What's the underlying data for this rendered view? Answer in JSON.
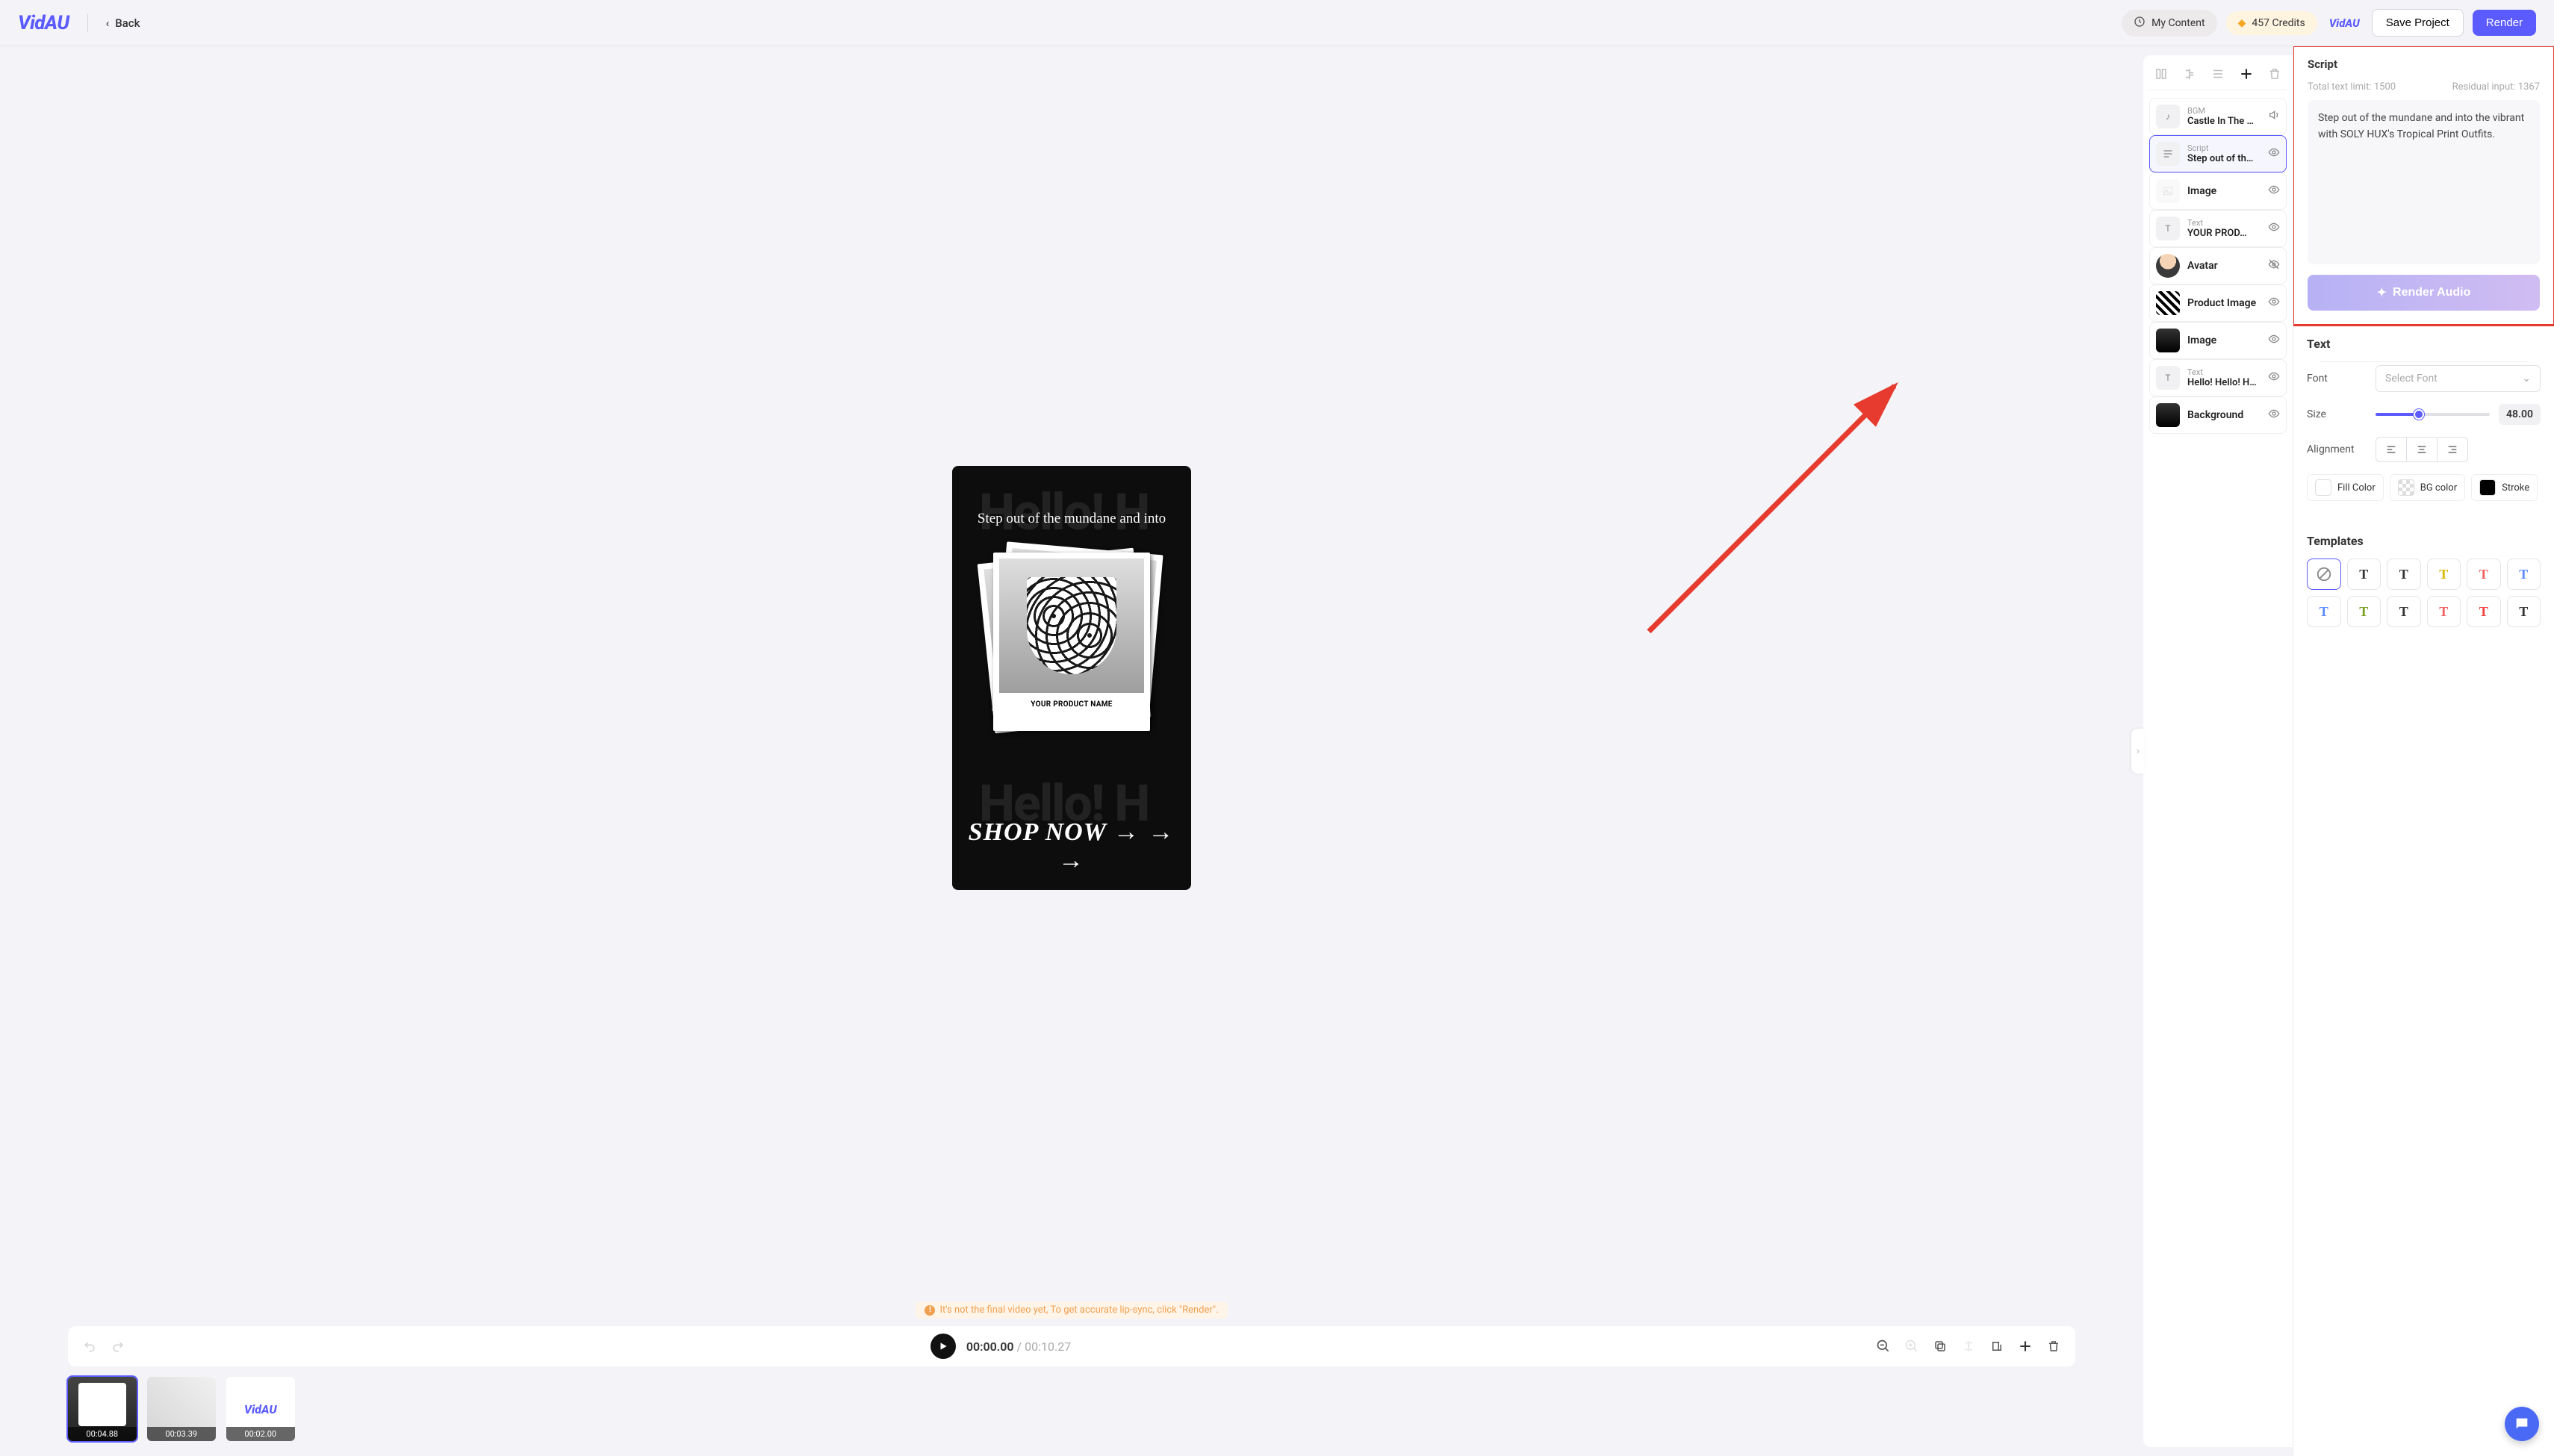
{
  "header": {
    "logo": "VidAU",
    "back": "Back",
    "my_content": "My Content",
    "credits": "457 Credits",
    "save": "Save Project",
    "render": "Render"
  },
  "canvas": {
    "headline": "Step out of the mundane and into",
    "product_caption": "YOUR PRODUCT NAME",
    "cta": "SHOP NOW",
    "bg_word": "Hello! H",
    "warning": "It's not the final video yet, To get accurate lip-sync, click \"Render\"."
  },
  "timeline": {
    "current": "00:00.00",
    "total": "00:10.27",
    "clips": [
      {
        "ts": "00:04.88"
      },
      {
        "ts": "00:03.39"
      },
      {
        "ts": "00:02.00"
      }
    ]
  },
  "layers": {
    "items": [
      {
        "label": "BGM",
        "value": "Castle In The …",
        "icon": "music",
        "right": "speaker"
      },
      {
        "label": "Script",
        "value": "Step out of th…",
        "icon": "script",
        "right": "eye",
        "active": true
      },
      {
        "label": "",
        "value": "Image",
        "icon": "image-faded",
        "right": "eye"
      },
      {
        "label": "Text",
        "value": "YOUR PROD…",
        "icon": "text",
        "right": "eye"
      },
      {
        "label": "",
        "value": "Avatar",
        "icon": "avatar",
        "right": "eye-off"
      },
      {
        "label": "",
        "value": "Product Image",
        "icon": "thumb-pat",
        "right": "eye"
      },
      {
        "label": "",
        "value": "Image",
        "icon": "thumb-dark",
        "right": "eye"
      },
      {
        "label": "Text",
        "value": "Hello! Hello! H…",
        "icon": "text",
        "right": "eye"
      },
      {
        "label": "",
        "value": "Background",
        "icon": "thumb-dark",
        "right": "eye"
      }
    ]
  },
  "script_panel": {
    "title": "Script",
    "limit_label": "Total text limit: 1500",
    "residual_label": "Residual input: 1367",
    "body": "Step out of the mundane and into the vibrant with SOLY HUX's Tropical Print Outfits.",
    "render_audio": "Render Audio"
  },
  "text_panel": {
    "title": "Text",
    "font_label": "Font",
    "font_placeholder": "Select Font",
    "size_label": "Size",
    "size_value": "48.00",
    "align_label": "Alignment",
    "fill_label": "Fill Color",
    "bg_label": "BG color",
    "stroke_label": "Stroke",
    "stroke_color": "#000000",
    "templates_title": "Templates",
    "template_colors": [
      "none",
      "#333333",
      "#333333",
      "#d9b800",
      "#f06060",
      "#5b8bff",
      "#5b8bff",
      "#7aa020",
      "#333333",
      "#f06060",
      "#f04040",
      "#333333"
    ]
  }
}
